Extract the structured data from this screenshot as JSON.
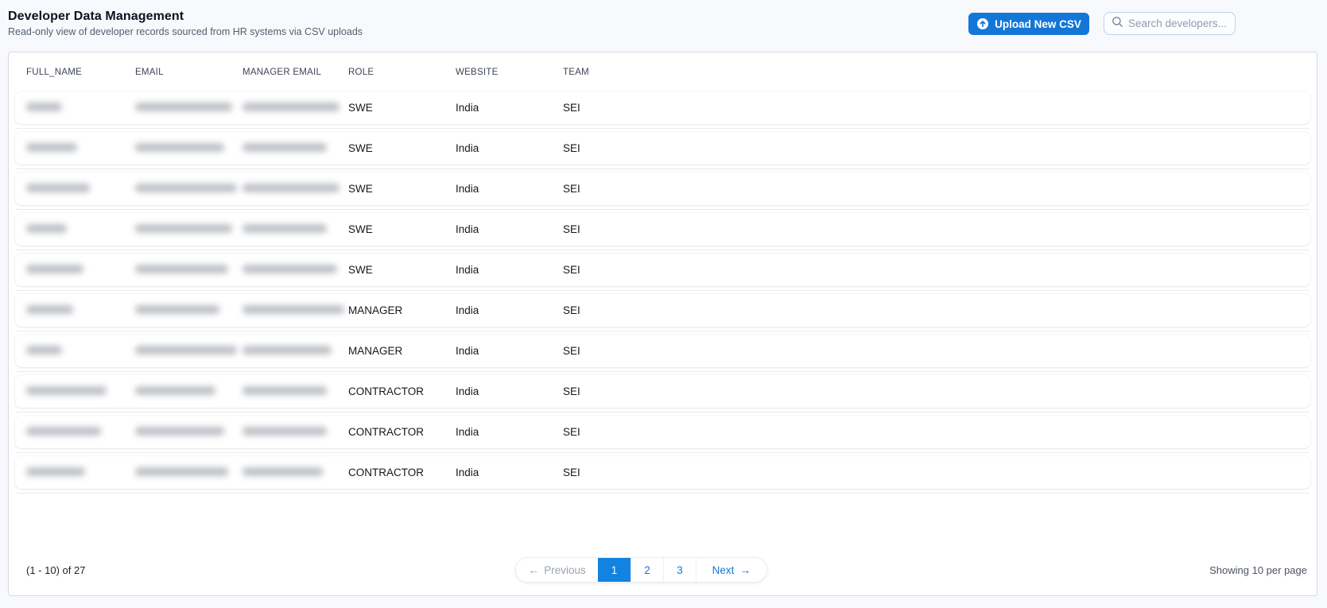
{
  "page": {
    "title": "Developer Data Management",
    "subtitle": "Read-only view of developer records sourced from HR systems via CSV uploads"
  },
  "toolbar": {
    "upload_button_label": "Upload New CSV",
    "search_placeholder": "Search developers..."
  },
  "icons": {
    "upload": "arrow-up-circle",
    "search": "magnifier",
    "arrow_left": "←",
    "arrow_right": "→"
  },
  "colors": {
    "accent_blue": "#1277d7",
    "active_page_blue": "#1283e0",
    "page_background": "#f7f9fc",
    "card_border": "#d7dae1",
    "muted_text": "#4c5461"
  },
  "table": {
    "columns": [
      "FULL_NAME",
      "EMAIL",
      "MANAGER EMAIL",
      "ROLE",
      "WEBSITE",
      "TEAM"
    ],
    "redaction_note": "full_name, email and manager_email values are blur-redacted in the screenshot",
    "rows": [
      {
        "redacted": true,
        "name_w": 45,
        "email_w": 122,
        "manager_w": 122,
        "role": "SWE",
        "website": "India",
        "team": "SEI"
      },
      {
        "redacted": true,
        "name_w": 64,
        "email_w": 112,
        "manager_w": 106,
        "role": "SWE",
        "website": "India",
        "team": "SEI"
      },
      {
        "redacted": true,
        "name_w": 80,
        "email_w": 128,
        "manager_w": 122,
        "role": "SWE",
        "website": "India",
        "team": "SEI"
      },
      {
        "redacted": true,
        "name_w": 51,
        "email_w": 122,
        "manager_w": 106,
        "role": "SWE",
        "website": "India",
        "team": "SEI"
      },
      {
        "redacted": true,
        "name_w": 72,
        "email_w": 117,
        "manager_w": 119,
        "role": "SWE",
        "website": "India",
        "team": "SEI"
      },
      {
        "redacted": true,
        "name_w": 59,
        "email_w": 106,
        "manager_w": 128,
        "role": "MANAGER",
        "website": "India",
        "team": "SEI"
      },
      {
        "redacted": true,
        "name_w": 45,
        "email_w": 128,
        "manager_w": 112,
        "role": "MANAGER",
        "website": "India",
        "team": "SEI"
      },
      {
        "redacted": true,
        "name_w": 101,
        "email_w": 101,
        "manager_w": 106,
        "role": "CONTRACTOR",
        "website": "India",
        "team": "SEI"
      },
      {
        "redacted": true,
        "name_w": 94,
        "email_w": 112,
        "manager_w": 106,
        "role": "CONTRACTOR",
        "website": "India",
        "team": "SEI"
      },
      {
        "redacted": true,
        "name_w": 74,
        "email_w": 117,
        "manager_w": 101,
        "role": "CONTRACTOR",
        "website": "India",
        "team": "SEI"
      }
    ]
  },
  "footer": {
    "range_label": "(1 - 10) of 27",
    "per_page_label": "Showing 10 per page",
    "pagination": {
      "previous_label": "Previous",
      "next_label": "Next",
      "pages": [
        "1",
        "2",
        "3"
      ],
      "active_page": "1"
    }
  }
}
